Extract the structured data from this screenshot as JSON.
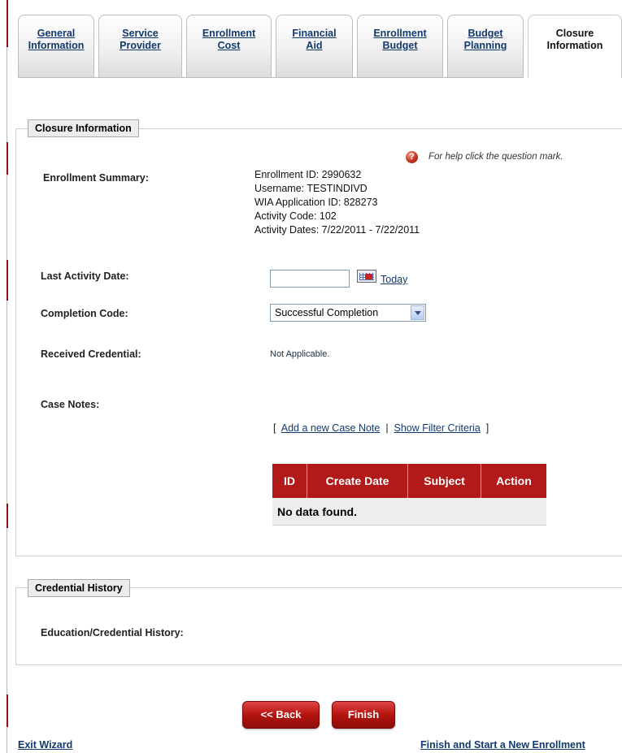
{
  "tabs": [
    {
      "label": "General\nInformation",
      "active": false
    },
    {
      "label": "Service\nProvider",
      "active": false
    },
    {
      "label": "Enrollment\nCost",
      "active": false
    },
    {
      "label": "Financial\nAid",
      "active": false
    },
    {
      "label": "Enrollment\nBudget",
      "active": false
    },
    {
      "label": "Budget\nPlanning",
      "active": false
    },
    {
      "label": "Closure\nInformation",
      "active": true
    }
  ],
  "closure": {
    "legend": "Closure Information",
    "help_text": "For help click the question mark.",
    "help_icon": "question-mark-icon",
    "summary_label": "Enrollment Summary:",
    "summary_lines": [
      "Enrollment ID: 2990632",
      "Username: TESTINDIVD",
      "WIA Application ID: 828273",
      "Activity Code: 102",
      "Activity Dates: 7/22/2011 - 7/22/2011"
    ],
    "last_activity_label": "Last Activity Date:",
    "last_activity_value": "",
    "today_link": "Today",
    "calendar_icon": "calendar-icon",
    "completion_label": "Completion Code:",
    "completion_value": "Successful Completion",
    "credential_label": "Received Credential:",
    "credential_value": "Not Applicable.",
    "case_notes_label": "Case Notes:",
    "bracket_open": "[",
    "bracket_sep": "|",
    "bracket_close": "]",
    "add_case_note_link": "Add a new Case Note",
    "filter_link": "Show Filter Criteria",
    "table": {
      "headers": [
        "ID",
        "Create Date",
        "Subject",
        "Action"
      ],
      "empty_text": "No data found."
    }
  },
  "credential_history": {
    "legend": "Credential History",
    "label": "Education/Credential History:"
  },
  "buttons": {
    "back": "<< Back",
    "finish": "Finish"
  },
  "footer": {
    "exit": "Exit Wizard",
    "finish_new": "Finish and Start a New Enrollment"
  },
  "colors": {
    "accent_red": "#b11a18",
    "link_blue": "#123a6e"
  }
}
